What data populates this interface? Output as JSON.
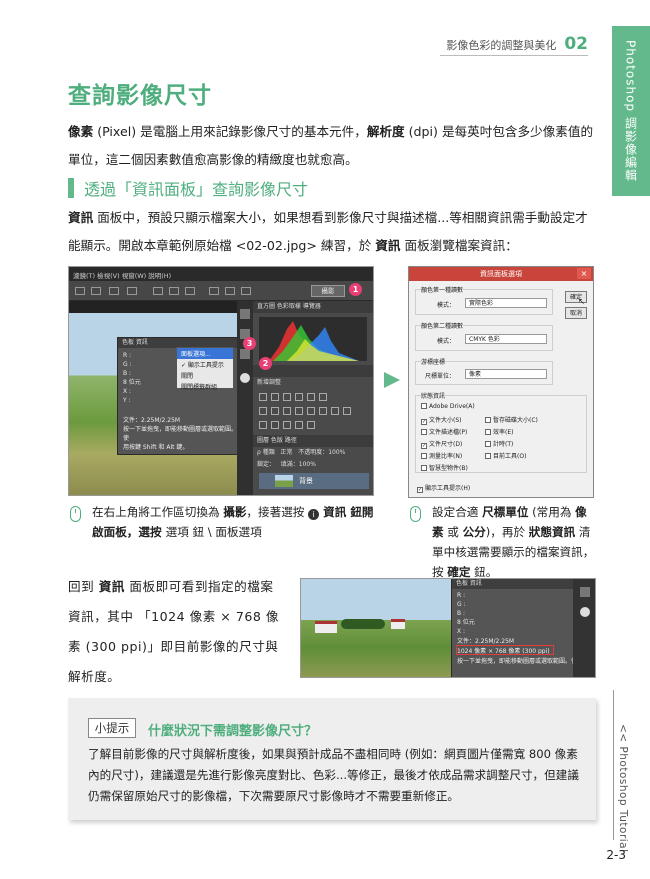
{
  "header": {
    "chapter_title": "影像色彩的調整與美化",
    "chapter_number": "02"
  },
  "side_tab": {
    "label": "Photoshop 調影像編輯"
  },
  "page_title": "查詢影像尺寸",
  "intro": {
    "t1": "像素",
    "t2": " (Pixel) 是電腦上用來記錄影像尺寸的基本元件，",
    "t3": "解析度",
    "t4": " (dpi) 是每英吋包含多少像素值的單位，這二個因素數值愈高影像的精緻度也就愈高。"
  },
  "section": {
    "title": "透過「資訊面板」查詢影像尺寸"
  },
  "para2": {
    "t1": "資訊",
    "t2": " 面板中，預設只顯示檔案大小，如果想看到影像尺寸與描述檔...等相關資訊需手動設定才能顯示。開啟本章範例原始檔 <02-02.jpg> 練習，於 ",
    "t3": "資訊",
    "t4": " 面板瀏覽檔案資訊："
  },
  "shot1": {
    "menubar": "濾鏡(T)  檢視(V)  視窗(W)  說明(H)",
    "workspace_button": "攝影",
    "info_tabs": "色板  資訊",
    "info_lines": [
      "R :",
      "G :",
      "B :",
      "8 位元",
      "X :",
      "Y :"
    ],
    "info_bottom": [
      "文件：2.25M/2.25M",
      "按一下並拖曳，即能移動圖層或選取範圍。使",
      "用按鍵 Shift 和 Alt 鍵。"
    ],
    "context_menu": [
      "面板選項...",
      "✓ 顯示工具提示",
      "關閉",
      "關閉標籤群組"
    ],
    "panel_tabs": "直方圖 色彩取樣  導覽器",
    "adjust_label": "新增調整",
    "layers_tabs": "圖層  色版  路徑",
    "layer_kind": "ρ 種類",
    "blend_mode": "正常",
    "opacity_label": "不透明度：",
    "opacity_value": "100%",
    "lock_label": "鎖定：",
    "fill_label": "填滿：",
    "fill_value": "100%",
    "layer_name": "背景",
    "badges": [
      "1",
      "2",
      "3"
    ]
  },
  "shot2": {
    "title": "資訊面板選項",
    "close": "×",
    "group1_label": "顏色第一種讀數",
    "group1_mode_label": "模式：",
    "group1_mode_value": "實際色彩",
    "group2_label": "顏色第二種讀數",
    "group2_mode_label": "模式：",
    "group2_mode_value": "CMYK 色彩",
    "units_label": "游標座標",
    "units_field_label": "尺標單位：",
    "units_value": "像素",
    "status_label": "狀態資訊",
    "ok": "確定",
    "cancel": "取消",
    "checkboxes": [
      {
        "label": "Adobe Drive(A)",
        "checked": false
      },
      {
        "label": "文件大小(S)",
        "checked": true
      },
      {
        "label": "暫存磁碟大小(C)",
        "checked": false
      },
      {
        "label": "文件描述檔(P)",
        "checked": false
      },
      {
        "label": "效率(E)",
        "checked": false
      },
      {
        "label": "文件尺寸(D)",
        "checked": true
      },
      {
        "label": "計時(T)",
        "checked": false
      },
      {
        "label": "測量比率(N)",
        "checked": false
      },
      {
        "label": "目前工具(O)",
        "checked": false
      },
      {
        "label": "智慧型物件(B)",
        "checked": false
      }
    ],
    "tooltip_option": "顯示工具提示(H)"
  },
  "caption1": {
    "t1": "在右上角將工作區切換為 ",
    "t2": "攝影",
    "t3": "，接著選按 ",
    "icon": "i",
    "t4": " 資訊 鈕開啟面板，選按 ",
    "kb": "☰",
    "t5": " 選項 鈕 \\ 面板選項",
    "t6": "。"
  },
  "caption2": {
    "t1": "設定合適 ",
    "t2": "尺標單位",
    "t3": " (常用為 ",
    "t4": "像素",
    "t5": " 或 ",
    "t6": "公分",
    "t7": ")，再於 ",
    "t8": "狀態資訊",
    "t9": " 清單中核選需要顯示的檔案資訊，按 ",
    "t10": "確定",
    "t11": " 鈕。"
  },
  "para3": {
    "t1": "回到 ",
    "t2": "資訊",
    "t3": " 面板即可看到指定的檔案資訊，其中 「1024 像素 × 768 像素 (300 ppi)」即目前影像的尺寸與解析度。"
  },
  "shot3": {
    "tabs": "色板  資訊",
    "lines": [
      "R :",
      "G :",
      "B :",
      "8 位元",
      "X :",
      "Y :"
    ],
    "status1": "文件：2.25M/2.25M",
    "status2": "1024 像素 × 768 像素 (300 ppi)",
    "status3": "按一下並拖曳，即能移動圖層或選取範圍。使"
  },
  "tip": {
    "tag": "小提示",
    "title": "什麼狀況下需調整影像尺寸？",
    "body": "了解目前影像的尺寸與解析度後，如果與預計成品不盡相同時 (例如：網頁圖片僅需寬 800 像素內的尺寸)，建議還是先進行影像亮度對比、色彩...等修正，最後才依成品需求調整尺寸，但建議仍需保留原始尺寸的影像檔，下次需要原尺寸影像時才不需要重新修正。"
  },
  "side_label": "<< Photoshop Tutorial",
  "page_number": "2-3",
  "colors": {
    "accent": "#4fae7e",
    "tab": "#63b98b",
    "badge": "#e83f74",
    "highlight": "#e53a3a"
  }
}
